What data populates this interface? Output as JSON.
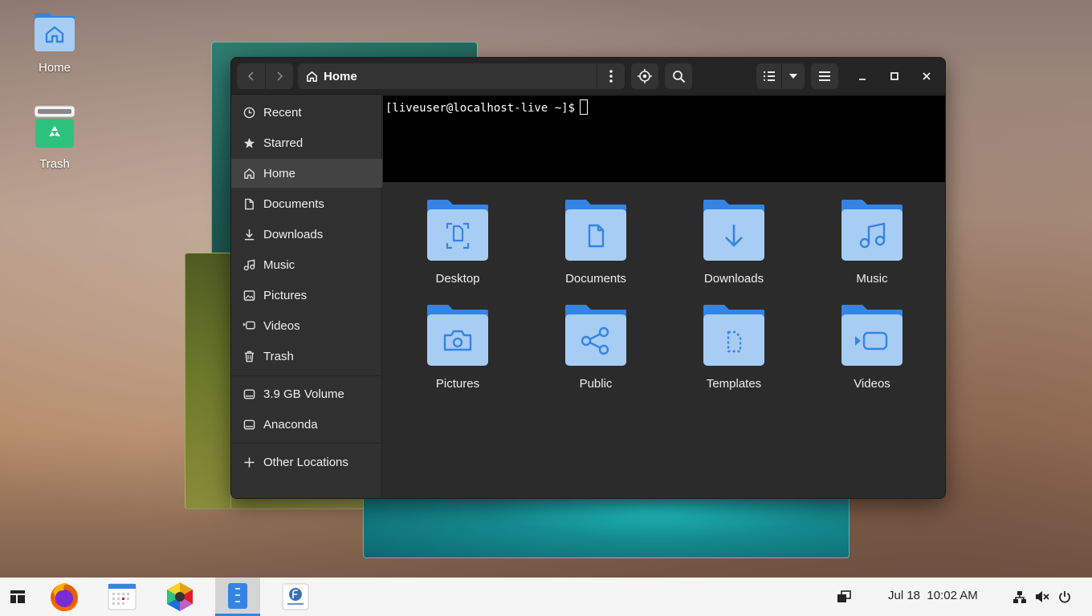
{
  "desktop": {
    "icons": [
      {
        "label": "Home"
      },
      {
        "label": "Trash"
      }
    ]
  },
  "window": {
    "path": {
      "current": "Home"
    },
    "sidebar": {
      "places": [
        {
          "label": "Recent",
          "icon": "clock-icon"
        },
        {
          "label": "Starred",
          "icon": "star-icon"
        },
        {
          "label": "Home",
          "icon": "home-icon",
          "active": true
        },
        {
          "label": "Documents",
          "icon": "document-icon"
        },
        {
          "label": "Downloads",
          "icon": "download-icon"
        },
        {
          "label": "Music",
          "icon": "music-icon"
        },
        {
          "label": "Pictures",
          "icon": "picture-icon"
        },
        {
          "label": "Videos",
          "icon": "video-icon"
        },
        {
          "label": "Trash",
          "icon": "trash-icon"
        }
      ],
      "devices": [
        {
          "label": "3.9 GB Volume",
          "icon": "drive-icon"
        },
        {
          "label": "Anaconda",
          "icon": "drive-icon"
        }
      ],
      "other": {
        "label": "Other Locations",
        "icon": "plus-icon"
      }
    },
    "terminal": {
      "prompt": "[liveuser@localhost-live ~]$"
    },
    "folders": [
      {
        "name": "Desktop",
        "icon": "desktop-folder-icon"
      },
      {
        "name": "Documents",
        "icon": "documents-folder-icon"
      },
      {
        "name": "Downloads",
        "icon": "downloads-folder-icon"
      },
      {
        "name": "Music",
        "icon": "music-folder-icon"
      },
      {
        "name": "Pictures",
        "icon": "pictures-folder-icon"
      },
      {
        "name": "Public",
        "icon": "public-folder-icon"
      },
      {
        "name": "Templates",
        "icon": "templates-folder-icon"
      },
      {
        "name": "Videos",
        "icon": "videos-folder-icon"
      }
    ]
  },
  "taskbar": {
    "apps": [
      "app-grid-icon",
      "firefox-icon",
      "calendar-icon",
      "color-picker-icon",
      "files-icon",
      "fedora-installer-icon"
    ],
    "active_app": "files-icon",
    "clock": {
      "date": "Jul 18",
      "time": "10:02 AM"
    },
    "tray": [
      "network-icon",
      "volume-muted-icon",
      "power-icon"
    ]
  },
  "colors": {
    "accent": "#3584e4",
    "folder": "#a7cdf5",
    "folder_tab": "#3584e4"
  }
}
